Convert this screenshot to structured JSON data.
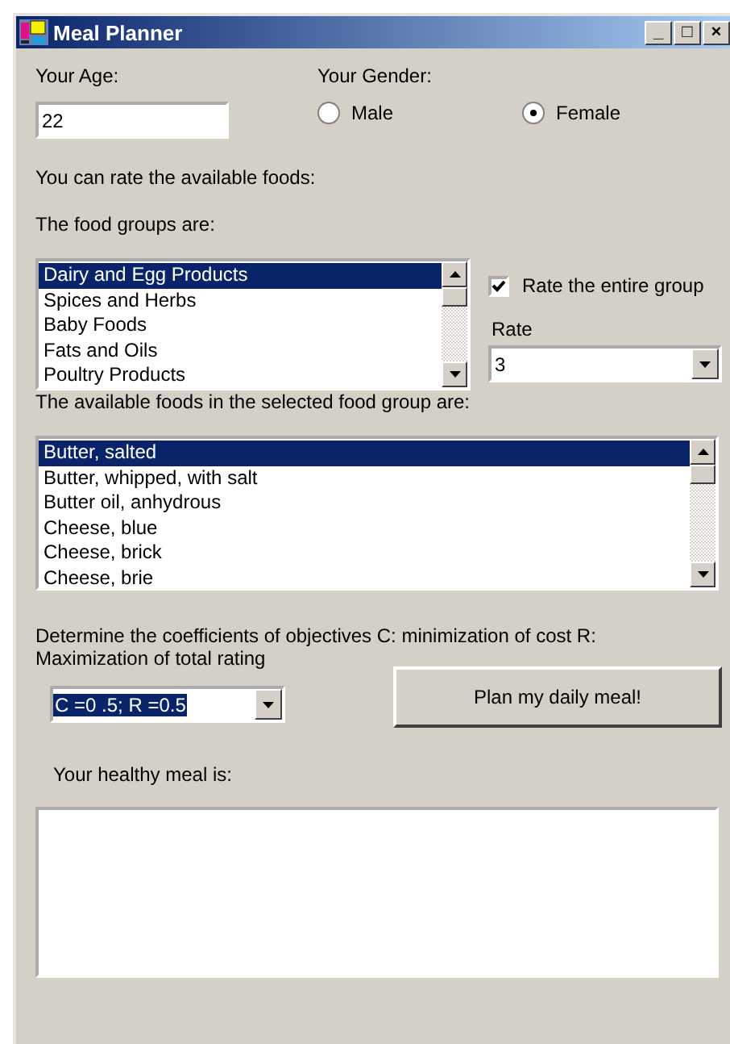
{
  "window": {
    "title": "Meal Planner",
    "controls": [
      "_",
      "□",
      "×"
    ]
  },
  "age": {
    "label": "Your Age:",
    "value": "22"
  },
  "gender": {
    "label": "Your Gender:",
    "options": [
      {
        "label": "Male",
        "selected": false
      },
      {
        "label": "Female",
        "selected": true
      }
    ]
  },
  "rate_intro": "You can rate the available foods:",
  "food_groups": {
    "label": "The food groups are:",
    "items": [
      {
        "label": "Dairy and Egg Products",
        "selected": true
      },
      {
        "label": "Spices and Herbs",
        "selected": false
      },
      {
        "label": "Baby Foods",
        "selected": false
      },
      {
        "label": "Fats and Oils",
        "selected": false
      },
      {
        "label": "Poultry Products",
        "selected": false
      }
    ]
  },
  "rate_group": {
    "label": "Rate the entire group",
    "checked": true
  },
  "rate": {
    "label": "Rate",
    "value": "3"
  },
  "foods": {
    "label": "The available foods in the selected food group are:",
    "items": [
      {
        "label": "Butter, salted",
        "selected": true
      },
      {
        "label": "Butter, whipped, with salt",
        "selected": false
      },
      {
        "label": "Butter oil, anhydrous",
        "selected": false
      },
      {
        "label": "Cheese, blue",
        "selected": false
      },
      {
        "label": "Cheese, brick",
        "selected": false
      },
      {
        "label": "Cheese, brie",
        "selected": false
      }
    ]
  },
  "coefficients": {
    "label": "Determine the coefficients of objectives C: minimization of cost R: Maximization of total rating",
    "value": "C =0 .5; R =0.5"
  },
  "plan_button": "Plan my daily meal!",
  "result": {
    "label": "Your healthy meal is:"
  }
}
